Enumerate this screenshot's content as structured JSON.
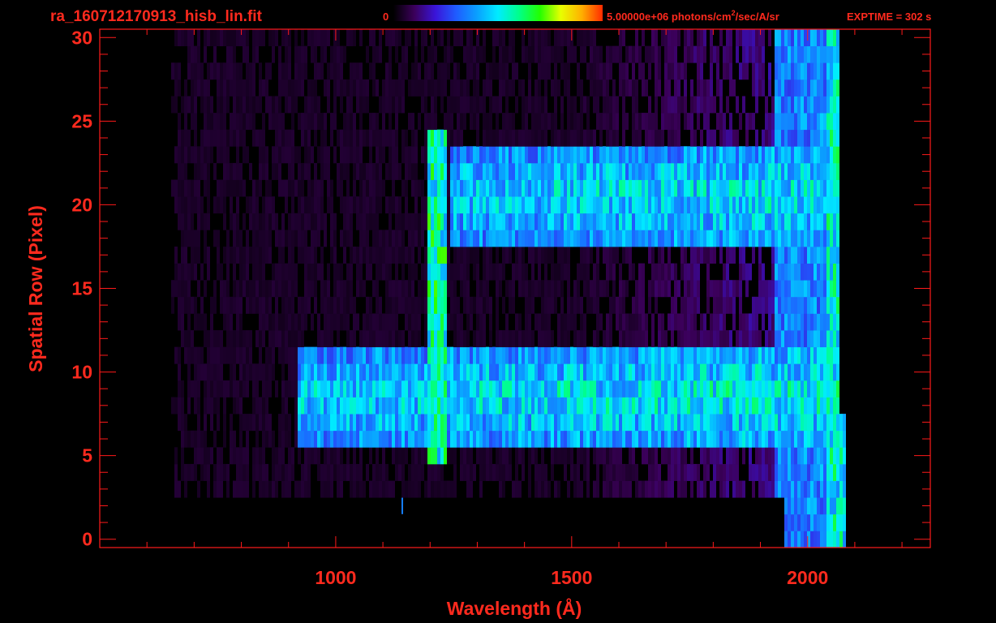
{
  "header": {
    "filename": "ra_160712170913_hisb_lin.fit",
    "cbar_min_label": "0",
    "cbar_max_label": "5.00000e+06 photons/cm",
    "cbar_max_sup": "2",
    "cbar_max_rest": "/sec/A/sr",
    "exptime_label": "EXPTIME = 302 s"
  },
  "colors": {
    "label": "#ff2a1e",
    "frame": "#ff1a1a",
    "background": "#000000",
    "colormap": [
      "#000000",
      "#3b005a",
      "#3a14d8",
      "#1f5cff",
      "#0aa0ff",
      "#00ecff",
      "#00ff8a",
      "#23ff00",
      "#e8ff00",
      "#ffb000",
      "#ff2a00"
    ]
  },
  "chart_data": {
    "type": "heatmap",
    "title": "ra_160712170913_hisb_lin.fit",
    "xlabel": "Wavelength (Å)",
    "ylabel": "Spatial Row (Pixel)",
    "xlim": [
      500,
      2260
    ],
    "ylim": [
      -0.5,
      30.5
    ],
    "xticks": [
      1000,
      1500,
      2000
    ],
    "yticks": [
      0,
      5,
      10,
      15,
      20,
      25,
      30
    ],
    "x_minor_step": 100,
    "y_minor_step": 1,
    "color_range": [
      0,
      5000000
    ],
    "color_units": "photons/cm^2/sec/A/sr",
    "rows": [
      0,
      30
    ],
    "wavelength_coverage": [
      660,
      2070
    ],
    "features": [
      {
        "kind": "continuum-band",
        "rows": [
          6,
          11
        ],
        "wavelength": [
          920,
          2070
        ]
      },
      {
        "kind": "continuum-band",
        "rows": [
          18,
          23
        ],
        "wavelength": [
          1240,
          2070
        ]
      },
      {
        "kind": "emission-line",
        "wavelength": 1216,
        "rows": [
          5,
          24
        ]
      }
    ]
  }
}
